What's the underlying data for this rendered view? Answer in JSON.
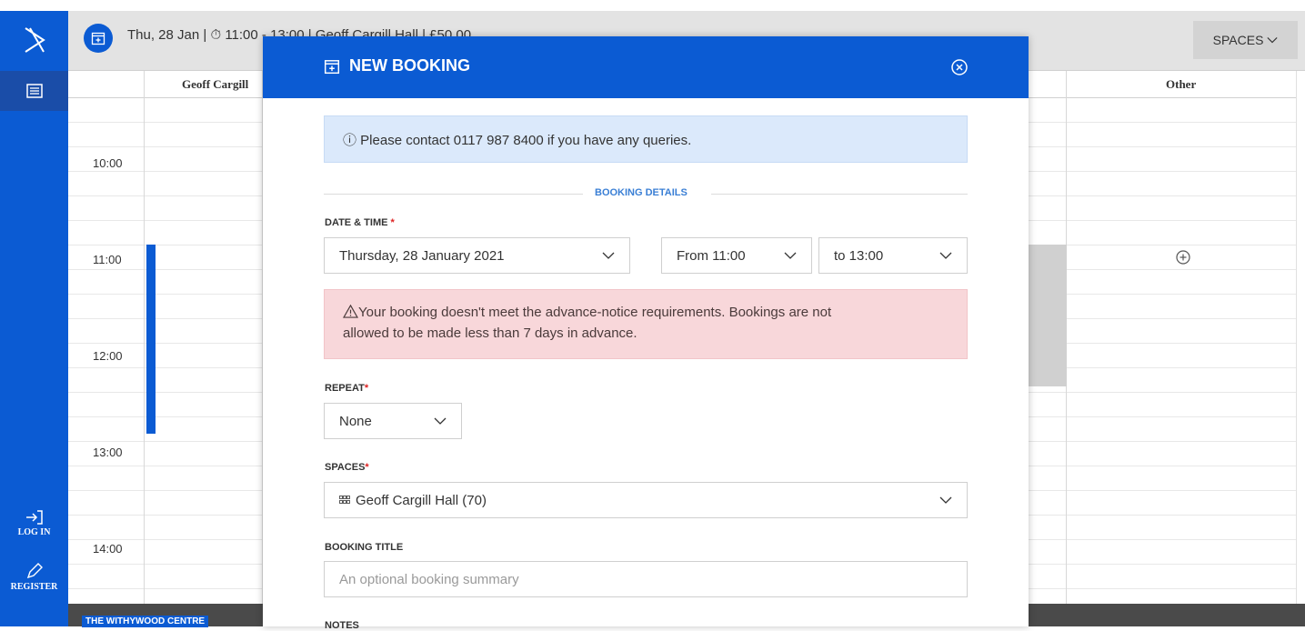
{
  "top_bar": {
    "summary": "Thu, 28 Jan  |  ⏱ 11:00 - 13:00  |  Geoff Cargill Hall  |  £50.00",
    "spaces_label": "SPACES"
  },
  "left_nav": {
    "login_label": "LOG IN",
    "register_label": "REGISTER"
  },
  "calendar": {
    "columns": [
      "Geoff Cargill",
      "Other"
    ],
    "times": [
      "10:00",
      "11:00",
      "12:00",
      "13:00",
      "14:00"
    ],
    "venue": "THE WITHYWOOD CENTRE"
  },
  "modal": {
    "title": "NEW BOOKING",
    "info": "ⓘ Please contact 0117 987 8400 if you have any queries.",
    "section_title": "BOOKING DETAILS",
    "date_time_label": "DATE & TIME",
    "date_value": "Thursday, 28 January 2021",
    "from_value": "From 11:00",
    "to_value": "to 13:00",
    "warning_line1": "Your booking doesn't meet the advance-notice requirements. Bookings are not",
    "warning_line2": "allowed to be made less than 7 days in advance.",
    "repeat_label": "REPEAT",
    "repeat_value": "None",
    "spaces_label": "SPACES",
    "spaces_value": "Geoff Cargill Hall (70)",
    "booking_title_label": "BOOKING TITLE",
    "booking_title_placeholder": "An optional booking summary",
    "notes_label": "NOTES",
    "required_mark": "*"
  },
  "colors": {
    "primary": "#0b5bd3",
    "info_bg": "#dbe9fb",
    "warning_bg": "#f8d7da"
  },
  "icons": [
    "logo-icon",
    "list-icon",
    "calendar-icon",
    "close-circle-icon",
    "chevron-down-icon",
    "login-icon",
    "pencil-icon",
    "grid-icon",
    "warning-icon",
    "add-circle-icon"
  ]
}
